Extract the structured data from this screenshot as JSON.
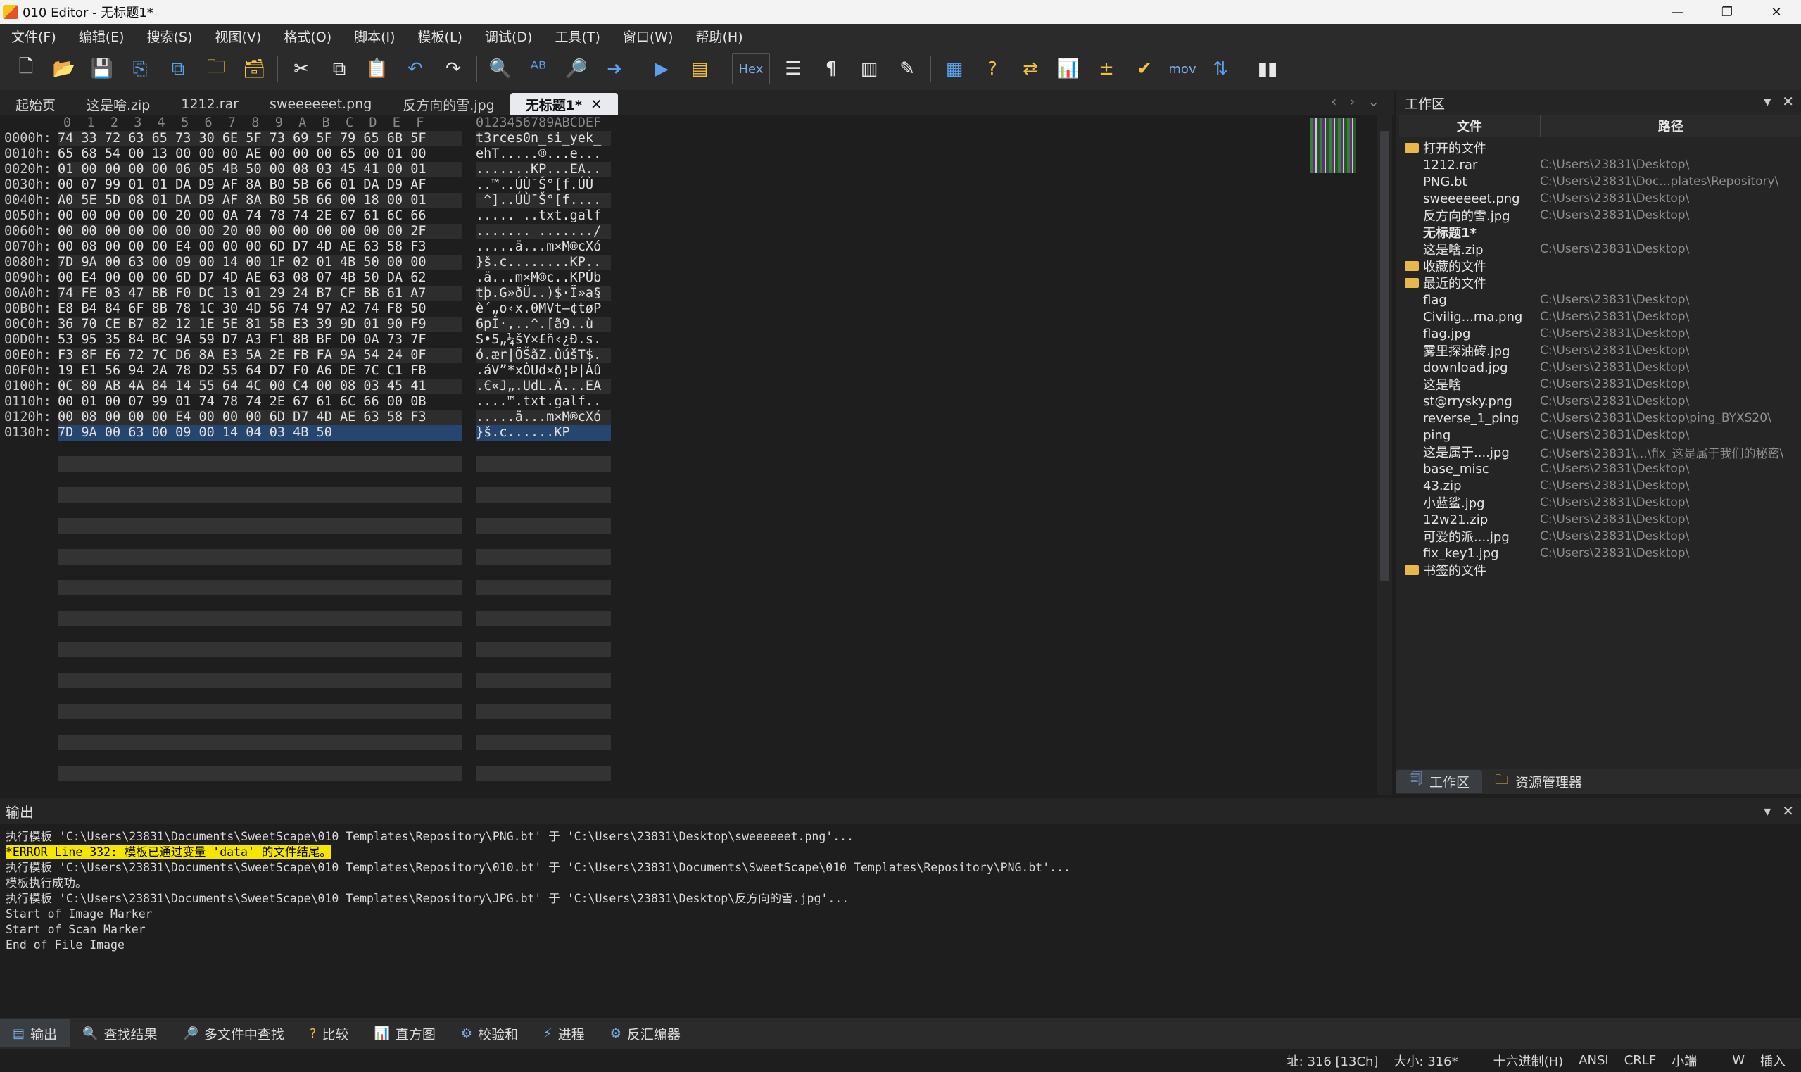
{
  "window": {
    "title": "010 Editor - 无标题1*",
    "minimize": "—",
    "maximize": "❐",
    "close": "✕"
  },
  "menu": [
    "文件(F)",
    "编辑(E)",
    "搜索(S)",
    "视图(V)",
    "格式(O)",
    "脚本(I)",
    "模板(L)",
    "调试(D)",
    "工具(T)",
    "窗口(W)",
    "帮助(H)"
  ],
  "toolbar": {
    "hex_label": "Hex",
    "mov_label": "mov"
  },
  "tabs": [
    {
      "label": "起始页",
      "active": false
    },
    {
      "label": "这是啥.zip",
      "active": false
    },
    {
      "label": "1212.rar",
      "active": false
    },
    {
      "label": "sweeeeeet.png",
      "active": false
    },
    {
      "label": "反方向的雪.jpg",
      "active": false
    },
    {
      "label": "无标题1*",
      "active": true
    }
  ],
  "tab_close": "✕",
  "tab_nav": {
    "prev": "‹",
    "next": "›",
    "list": "⌄"
  },
  "hex": {
    "column_header": "0  1  2  3  4  5  6  7  8  9  A  B  C  D  E  F",
    "ascii_header": "0123456789ABCDEF",
    "rows": [
      {
        "addr": "0000h:",
        "bytes": "74 33 72 63 65 73 30 6E 5F 73 69 5F 79 65 6B 5F",
        "ascii": "t3rces0n_si_yek_"
      },
      {
        "addr": "0010h:",
        "bytes": "65 68 54 00 13 00 00 00 AE 00 00 00 65 00 01 00",
        "ascii": "ehT.....®...e..."
      },
      {
        "addr": "0020h:",
        "bytes": "01 00 00 00 00 06 05 4B 50 00 08 03 45 41 00 01",
        "ascii": ".......KP...EA.."
      },
      {
        "addr": "0030h:",
        "bytes": "00 07 99 01 01 DA D9 AF 8A B0 5B 66 01 DA D9 AF",
        "ascii": "..™..ÚÙ¯Š°[f.ÚÙ"
      },
      {
        "addr": "0040h:",
        "bytes": "A0 5E 5D 08 01 DA D9 AF 8A B0 5B 66 00 18 00 01",
        "ascii": " ^]..ÚÙ¯Š°[f...."
      },
      {
        "addr": "0050h:",
        "bytes": "00 00 00 00 00 20 00 0A 74 78 74 2E 67 61 6C 66",
        "ascii": "..... ..txt.galf"
      },
      {
        "addr": "0060h:",
        "bytes": "00 00 00 00 00 00 00 20 00 00 00 00 00 00 00 2F",
        "ascii": "....... ......./"
      },
      {
        "addr": "0070h:",
        "bytes": "00 08 00 00 00 E4 00 00 00 6D D7 4D AE 63 58 F3",
        "ascii": ".....ä...m×M®cXó"
      },
      {
        "addr": "0080h:",
        "bytes": "7D 9A 00 63 00 09 00 14 00 1F 02 01 4B 50 00 00",
        "ascii": "}š.c........KP.."
      },
      {
        "addr": "0090h:",
        "bytes": "00 E4 00 00 00 6D D7 4D AE 63 08 07 4B 50 DA 62",
        "ascii": ".ä...m×M®c..KPÚb"
      },
      {
        "addr": "00A0h:",
        "bytes": "74 FE 03 47 BB F0 DC 13 01 29 24 B7 CF BB 61 A7",
        "ascii": "tþ.G»ðÜ..)$·Ï»a§"
      },
      {
        "addr": "00B0h:",
        "bytes": "E8 B4 84 6F 8B 78 1C 30 4D 56 74 97 A2 74 F8 50",
        "ascii": "è´„o‹x.0MVt—¢tøP"
      },
      {
        "addr": "00C0h:",
        "bytes": "36 70 CE B7 82 12 1E 5E 81 5B E3 39 9D 01 90 F9",
        "ascii": "6pÎ·‚..^.[ã9..ù"
      },
      {
        "addr": "00D0h:",
        "bytes": "53 95 35 84 BC 9A 59 D7 A3 F1 8B BF D0 0A 73 7F",
        "ascii": "S•5„¼šY×£ñ‹¿Ð.s."
      },
      {
        "addr": "00E0h:",
        "bytes": "F3 8F E6 72 7C D6 8A E3 5A 2E FB FA 9A 54 24 0F",
        "ascii": "ó.ær|ÖŠãZ.ûúšT$."
      },
      {
        "addr": "00F0h:",
        "bytes": "19 E1 56 94 2A 78 D2 55 64 D7 F0 A6 DE 7C C1 FB",
        "ascii": ".áV”*xÒUd×ð¦Þ|Áû"
      },
      {
        "addr": "0100h:",
        "bytes": "0C 80 AB 4A 84 14 55 64 4C 00 C4 00 08 03 45 41",
        "ascii": ".€«J„.UdL.Ä...EA"
      },
      {
        "addr": "0110h:",
        "bytes": "00 01 00 07 99 01 74 78 74 2E 67 61 6C 66 00 0B",
        "ascii": "....™.txt.galf.."
      },
      {
        "addr": "0120h:",
        "bytes": "00 08 00 00 00 E4 00 00 00 6D D7 4D AE 63 58 F3",
        "ascii": ".....ä...m×M®cXó"
      },
      {
        "addr": "0130h:",
        "bytes": "7D 9A 00 63 00 09 00 14 04 03 4B 50",
        "ascii": "}š.c......KP"
      }
    ]
  },
  "workspace": {
    "title": "工作区",
    "col_file": "文件",
    "col_path": "路径",
    "groups": [
      {
        "label": "打开的文件",
        "items": [
          {
            "name": "1212.rar",
            "path": "C:\\Users\\23831\\Desktop\\"
          },
          {
            "name": "PNG.bt",
            "path": "C:\\Users\\23831\\Doc...plates\\Repository\\"
          },
          {
            "name": "sweeeeeet.png",
            "path": "C:\\Users\\23831\\Desktop\\"
          },
          {
            "name": "反方向的雪.jpg",
            "path": "C:\\Users\\23831\\Desktop\\"
          },
          {
            "name": "无标题1*",
            "path": ""
          },
          {
            "name": "这是啥.zip",
            "path": "C:\\Users\\23831\\Desktop\\"
          }
        ]
      },
      {
        "label": "收藏的文件",
        "items": []
      },
      {
        "label": "最近的文件",
        "items": [
          {
            "name": "flag",
            "path": "C:\\Users\\23831\\Desktop\\"
          },
          {
            "name": "Civilig...rna.png",
            "path": "C:\\Users\\23831\\Desktop\\"
          },
          {
            "name": "flag.jpg",
            "path": "C:\\Users\\23831\\Desktop\\"
          },
          {
            "name": "雾里探油砖.jpg",
            "path": "C:\\Users\\23831\\Desktop\\"
          },
          {
            "name": "download.jpg",
            "path": "C:\\Users\\23831\\Desktop\\"
          },
          {
            "name": "这是啥",
            "path": "C:\\Users\\23831\\Desktop\\"
          },
          {
            "name": "st@rrysky.png",
            "path": "C:\\Users\\23831\\Desktop\\"
          },
          {
            "name": "reverse_1_ping",
            "path": "C:\\Users\\23831\\Desktop\\ping_BYXS20\\"
          },
          {
            "name": "ping",
            "path": "C:\\Users\\23831\\Desktop\\"
          },
          {
            "name": "这是属于....jpg",
            "path": "C:\\Users\\23831\\...\\fix_这是属于我们的秘密\\"
          },
          {
            "name": "base_misc",
            "path": "C:\\Users\\23831\\Desktop\\"
          },
          {
            "name": "43.zip",
            "path": "C:\\Users\\23831\\Desktop\\"
          },
          {
            "name": "小蓝鲨.jpg",
            "path": "C:\\Users\\23831\\Desktop\\"
          },
          {
            "name": "12w21.zip",
            "path": "C:\\Users\\23831\\Desktop\\"
          },
          {
            "name": "可爱的派....jpg",
            "path": "C:\\Users\\23831\\Desktop\\"
          },
          {
            "name": "fix_key1.jpg",
            "path": "C:\\Users\\23831\\Desktop\\"
          }
        ]
      },
      {
        "label": "书签的文件",
        "items": []
      }
    ],
    "tab_workspace": "工作区",
    "tab_explorer": "资源管理器"
  },
  "output": {
    "title": "输出",
    "lines": [
      "执行模板 'C:\\Users\\23831\\Documents\\SweetScape\\010 Templates\\Repository\\PNG.bt' 于 'C:\\Users\\23831\\Desktop\\sweeeeeet.png'...",
      "*ERROR Line 332: 模板已通过变量 'data' 的文件结尾。",
      "执行模板 'C:\\Users\\23831\\Documents\\SweetScape\\010 Templates\\Repository\\010.bt' 于 'C:\\Users\\23831\\Documents\\SweetScape\\010 Templates\\Repository\\PNG.bt'...",
      "模板执行成功。",
      "执行模板 'C:\\Users\\23831\\Documents\\SweetScape\\010 Templates\\Repository\\JPG.bt' 于 'C:\\Users\\23831\\Desktop\\反方向的雪.jpg'...",
      "Start of Image Marker",
      "Start of Scan Marker",
      "End of File Image"
    ]
  },
  "bottom_tabs": [
    "输出",
    "查找结果",
    "多文件中查找",
    "比较",
    "直方图",
    "校验和",
    "进程",
    "反汇编器"
  ],
  "status": {
    "address": "址: 316 [13Ch]",
    "size": "大小: 316*",
    "mode": "十六进制(H)",
    "charset": "ANSI",
    "lineend": "CRLF",
    "endian": "小端",
    "w": "W",
    "insert": "插入"
  }
}
